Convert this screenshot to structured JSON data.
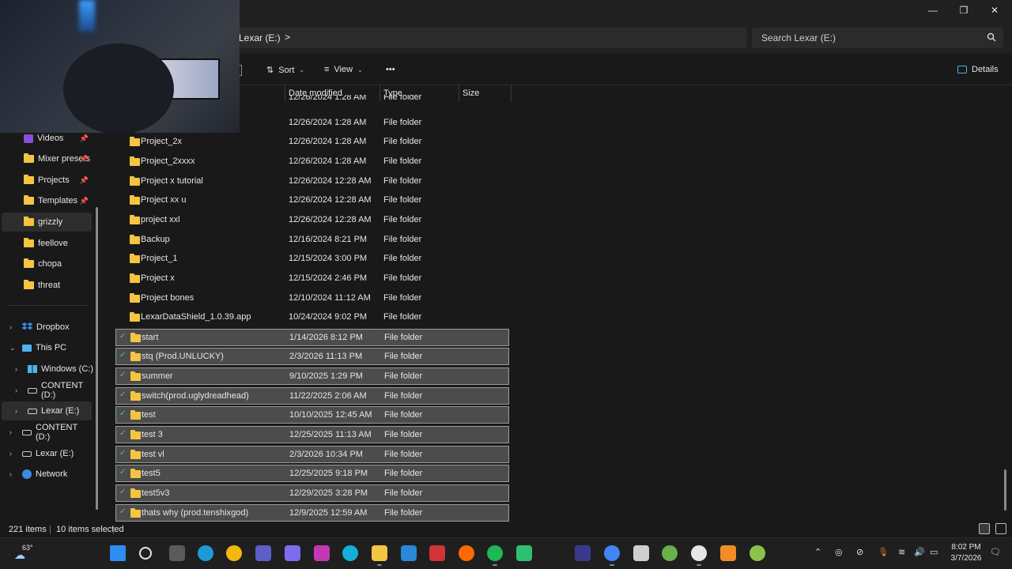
{
  "window": {
    "minimize": "—",
    "maximize": "❐",
    "close": "✕"
  },
  "address": {
    "crumb": "Lexar (E:)",
    "chevron": ">",
    "search_placeholder": "Search Lexar (E:)"
  },
  "commands": {
    "sort": "Sort",
    "view": "View",
    "more": "•••",
    "details": "Details"
  },
  "columns": {
    "date": "Date modified",
    "type": "Type",
    "size": "Size"
  },
  "sidebar": {
    "quick": [
      {
        "label": "Videos",
        "pinned": true
      },
      {
        "label": "Mixer presets",
        "pinned": true
      },
      {
        "label": "Projects",
        "pinned": true
      },
      {
        "label": "Templates",
        "pinned": true
      },
      {
        "label": "grizzly",
        "pinned": false
      },
      {
        "label": "feellove",
        "pinned": false
      },
      {
        "label": "chopa",
        "pinned": false
      },
      {
        "label": "threat",
        "pinned": false
      }
    ],
    "tree": {
      "dropbox": "Dropbox",
      "this_pc": "This PC",
      "windows_c": "Windows (C:)",
      "content_d": "CONTENT (D:)",
      "lexar_e": "Lexar (E:)",
      "content_d2": "CONTENT (D:)",
      "lexar_e2": "Lexar (E:)",
      "network": "Network"
    }
  },
  "files": [
    {
      "name": "",
      "date": "12/26/2024 1:28 AM",
      "type": "File folder",
      "selected": false
    },
    {
      "name": "",
      "date": "12/26/2024 1:28 AM",
      "type": "File folder",
      "selected": false
    },
    {
      "name": "Project_2x",
      "date": "12/26/2024 1:28 AM",
      "type": "File folder",
      "selected": false
    },
    {
      "name": "Project_2xxxx",
      "date": "12/26/2024 1:28 AM",
      "type": "File folder",
      "selected": false
    },
    {
      "name": "Project x tutorial",
      "date": "12/26/2024 12:28 AM",
      "type": "File folder",
      "selected": false
    },
    {
      "name": "Project xx u",
      "date": "12/26/2024 12:28 AM",
      "type": "File folder",
      "selected": false
    },
    {
      "name": "project xxl",
      "date": "12/26/2024 12:28 AM",
      "type": "File folder",
      "selected": false
    },
    {
      "name": "Backup",
      "date": "12/16/2024 8:21 PM",
      "type": "File folder",
      "selected": false
    },
    {
      "name": "Project_1",
      "date": "12/15/2024 3:00 PM",
      "type": "File folder",
      "selected": false
    },
    {
      "name": "Project x",
      "date": "12/15/2024 2:46 PM",
      "type": "File folder",
      "selected": false
    },
    {
      "name": "Project bones",
      "date": "12/10/2024 11:12 AM",
      "type": "File folder",
      "selected": false
    },
    {
      "name": "LexarDataShield_1.0.39.app",
      "date": "10/24/2024 9:02 PM",
      "type": "File folder",
      "selected": false
    },
    {
      "name": "start",
      "date": "1/14/2026 8:12 PM",
      "type": "File folder",
      "selected": true
    },
    {
      "name": "stq (Prod.UNLUCKY)",
      "date": "2/3/2026 11:13 PM",
      "type": "File folder",
      "selected": true
    },
    {
      "name": "summer",
      "date": "9/10/2025 1:29 PM",
      "type": "File folder",
      "selected": true
    },
    {
      "name": "switch(prod.uglydreadhead)",
      "date": "11/22/2025 2:06 AM",
      "type": "File folder",
      "selected": true
    },
    {
      "name": "test",
      "date": "10/10/2025 12:45 AM",
      "type": "File folder",
      "selected": true
    },
    {
      "name": "test 3",
      "date": "12/25/2025 11:13 AM",
      "type": "File folder",
      "selected": true
    },
    {
      "name": "test vl",
      "date": "2/3/2026 10:34 PM",
      "type": "File folder",
      "selected": true
    },
    {
      "name": "test5",
      "date": "12/25/2025 9:18 PM",
      "type": "File folder",
      "selected": true
    },
    {
      "name": "test5v3",
      "date": "12/29/2025 3:28 PM",
      "type": "File folder",
      "selected": true
    },
    {
      "name": "thats why (prod.tenshixgod)",
      "date": "12/9/2025 12:59 AM",
      "type": "File folder",
      "selected": true
    }
  ],
  "status": {
    "count": "221 items",
    "selected": "10 items selected"
  },
  "taskbar": {
    "weather": "63°",
    "time": "8:02 PM",
    "date": "3/7/2026",
    "icons": [
      "start-icon",
      "search-icon",
      "task-view-icon",
      "edge-icon",
      "widget-icon",
      "teams-icon",
      "copilot-icon",
      "app-p-icon",
      "cortana-icon",
      "file-explorer-icon",
      "store-icon",
      "app-red-icon",
      "soundcloud-icon",
      "spotify-icon",
      "app-green-icon",
      "app-dark-icon",
      "chrome-icon",
      "app-f-icon",
      "utorrent-icon",
      "obs-icon",
      "fl-studio-icon",
      "app-plus-icon"
    ],
    "colors": [
      "#2f8cf0",
      "#e6e6e6",
      "#5a5a5a",
      "#1e9bd7",
      "#f2b90c",
      "#5b5fc7",
      "#7b6cf0",
      "#c239b3",
      "#12b0d8",
      "#f4c542",
      "#2b88d8",
      "#d13438",
      "#ff6a00",
      "#1db954",
      "#2fbf71",
      "#3a3a8a",
      "#4285f4",
      "#cfcfcf",
      "#6ab04c",
      "#e6e6e6",
      "#f28c28",
      "#8bc34a"
    ]
  }
}
